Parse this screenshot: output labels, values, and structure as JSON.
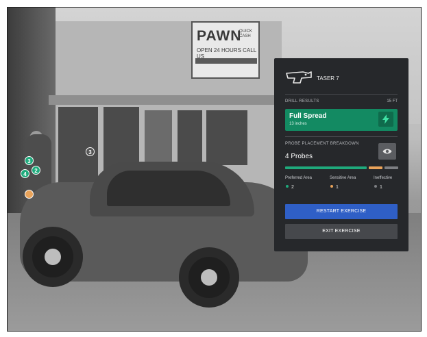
{
  "background": {
    "sign": {
      "title": "PAWN",
      "quick": "QUICK CASH",
      "hours": "OPEN 24 HOURS  CALL US"
    }
  },
  "markers": [
    {
      "label": "3",
      "area": "preferred"
    },
    {
      "label": "4",
      "area": "preferred"
    },
    {
      "label": "2",
      "area": "preferred"
    },
    {
      "label": "",
      "area": "sensitive"
    },
    {
      "label": "3",
      "area": "ineffective"
    }
  ],
  "panel": {
    "device_label": "TASER 7",
    "device_icon": "taser-icon",
    "drill_results_title": "DRILL RESULTS",
    "distance": "15 FT",
    "result": {
      "title": "Full Spread",
      "subtitle": "13 inches",
      "icon": "lightning-bolt-icon"
    },
    "breakdown_title": "PROBE PLACEMENT BREAKDOWN",
    "probe_count": "4 Probes",
    "eye_icon": "eye-icon",
    "breakdown": [
      {
        "label": "Preferred Area",
        "count": "2",
        "color": "#1faa7c",
        "share": 0.75
      },
      {
        "label": "Sensitive Area",
        "count": "1",
        "color": "#e9a35a",
        "share": 0.125
      },
      {
        "label": "Ineffective",
        "count": "1",
        "color": "#7d7f83",
        "share": 0.125
      }
    ],
    "restart_label": "RESTART EXERCISE",
    "exit_label": "EXIT EXERCISE"
  }
}
